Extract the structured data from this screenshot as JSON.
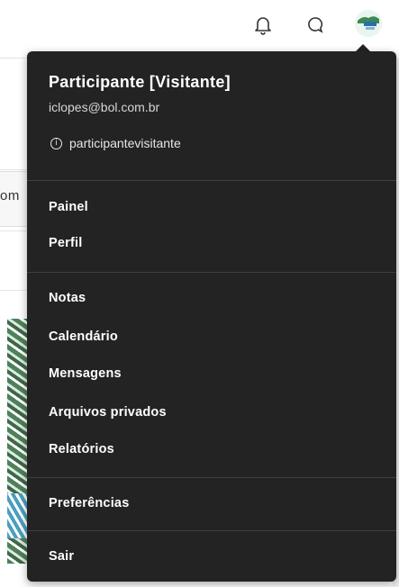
{
  "navbar": {
    "notification_icon": "bell-icon",
    "messages_icon": "chat-bubble-icon",
    "avatar_alt": "user-avatar"
  },
  "background": {
    "card_text": "om"
  },
  "user_menu": {
    "name": "Participante [Visitante]",
    "email": "iclopes@bol.com.br",
    "login_info_icon": "info-icon",
    "username": "participantevisitante",
    "groups": [
      {
        "items": [
          {
            "label": "Painel"
          },
          {
            "label": "Perfil"
          }
        ]
      },
      {
        "items": [
          {
            "label": "Notas"
          },
          {
            "label": "Calendário"
          },
          {
            "label": "Mensagens"
          },
          {
            "label": "Arquivos privados"
          },
          {
            "label": "Relatórios"
          }
        ]
      },
      {
        "items": [
          {
            "label": "Preferências"
          }
        ]
      },
      {
        "items": [
          {
            "label": "Sair"
          }
        ]
      }
    ]
  },
  "colors": {
    "dropdown_bg": "#232323",
    "text": "#ffffff",
    "divider": "#3f3f3f"
  }
}
